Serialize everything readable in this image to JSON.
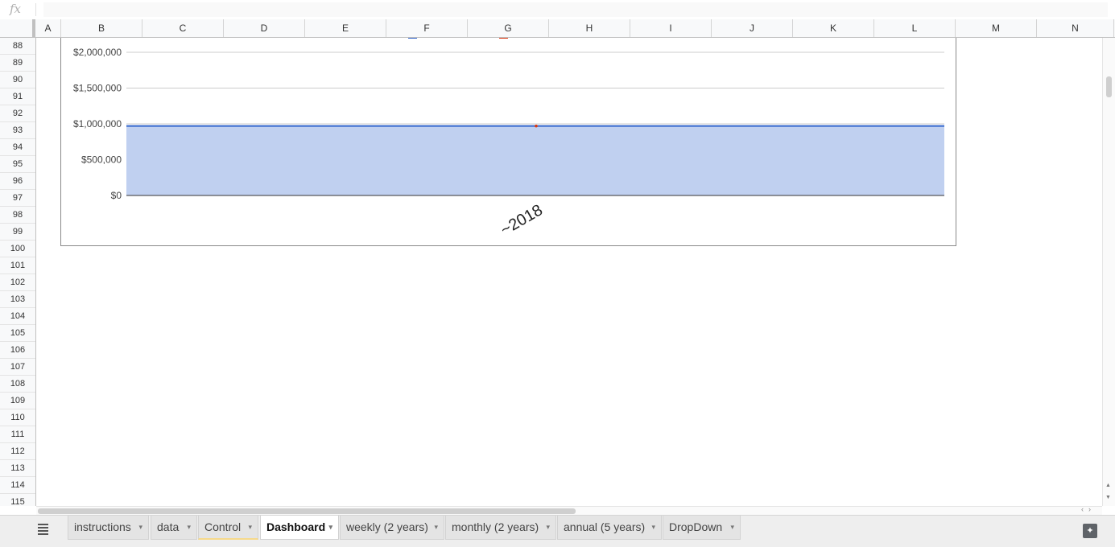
{
  "formula_bar": {
    "fx_label": "fx",
    "value": ""
  },
  "columns": [
    "A",
    "B",
    "C",
    "D",
    "E",
    "F",
    "G",
    "H",
    "I",
    "J",
    "K",
    "L",
    "M",
    "N"
  ],
  "rows": [
    "88",
    "89",
    "90",
    "91",
    "92",
    "93",
    "94",
    "95",
    "96",
    "97",
    "98",
    "99",
    "100",
    "101",
    "102",
    "103",
    "104",
    "105",
    "106",
    "107",
    "108",
    "109",
    "110",
    "111",
    "112",
    "113",
    "114",
    "115"
  ],
  "chart_data": {
    "type": "area",
    "x": [
      "2018"
    ],
    "x_tick_label": "~2018",
    "series": [
      {
        "values": [
          970000
        ],
        "color": "#3366cc",
        "fill": "#c0d0f0"
      },
      {
        "values": [
          970000
        ],
        "color": "#dc3912"
      }
    ],
    "y_ticks": [
      "$0",
      "$500,000",
      "$1,000,000",
      "$1,500,000",
      "$2,000,000"
    ],
    "ylim": [
      0,
      2000000
    ],
    "grid": true,
    "legend": "top"
  },
  "tabs": [
    {
      "label": "instructions"
    },
    {
      "label": "data"
    },
    {
      "label": "Control"
    },
    {
      "label": "Dashboard",
      "active": true
    },
    {
      "label": "weekly (2 years)"
    },
    {
      "label": "monthly (2 years)"
    },
    {
      "label": "annual (5 years)"
    },
    {
      "label": "DropDown"
    }
  ],
  "icons": {
    "all_sheets": "list-icon",
    "explore": "explore-icon",
    "caret": "▾"
  }
}
